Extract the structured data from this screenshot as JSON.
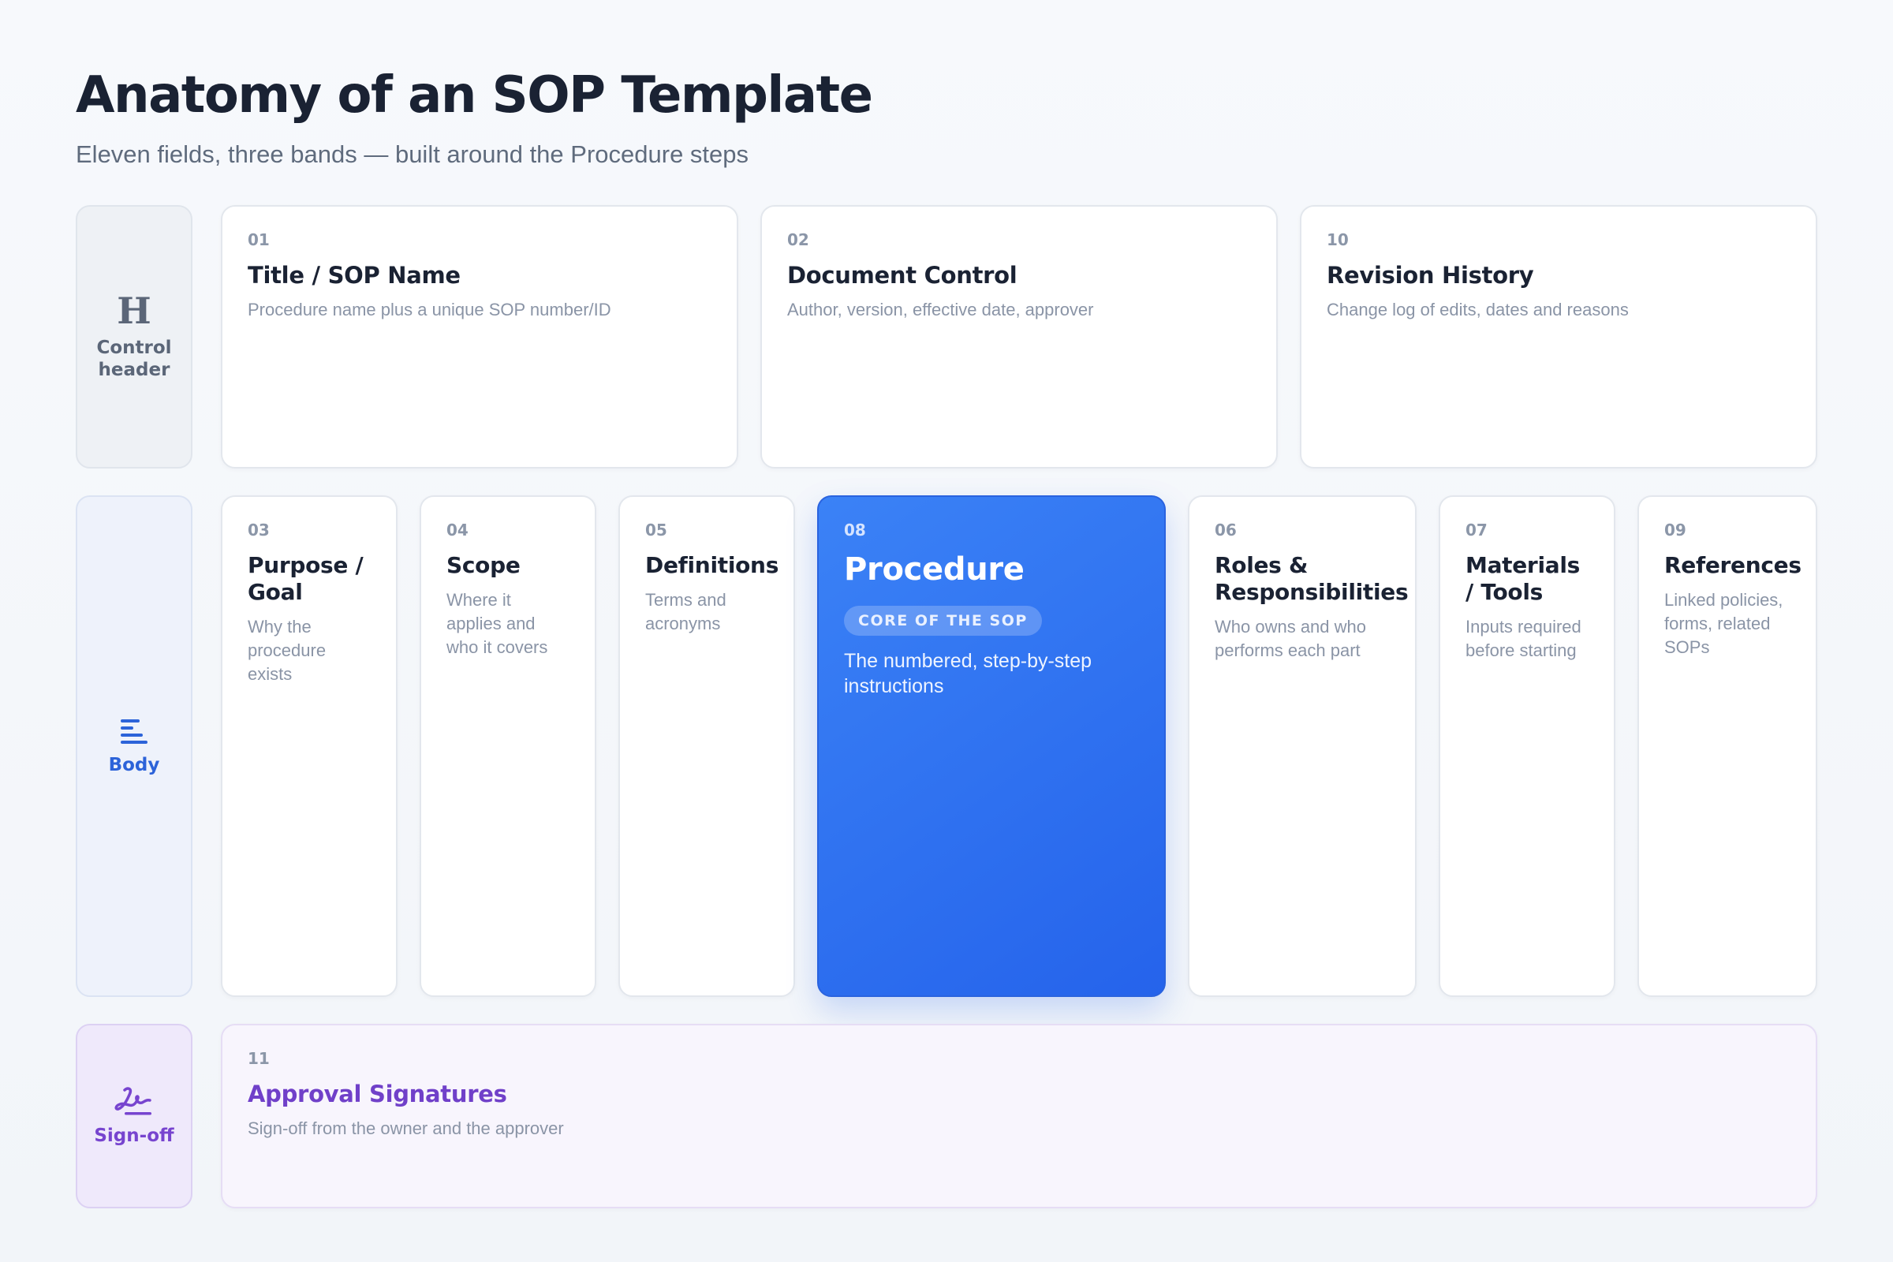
{
  "header": {
    "title": "Anatomy of an SOP Template",
    "subtitle": "Eleven fields, three bands — built around the Procedure steps"
  },
  "bands": {
    "header": {
      "icon": "h-letter-icon",
      "icon_glyph": "H",
      "label": "Control\nheader"
    },
    "body": {
      "icon": "text-lines-icon",
      "label": "Body"
    },
    "sign": {
      "icon": "signature-icon",
      "label": "Sign-off"
    }
  },
  "fields": {
    "f01": {
      "num": "01",
      "name": "Title / SOP Name",
      "desc": "Procedure name plus a unique SOP number/ID"
    },
    "f02": {
      "num": "02",
      "name": "Document Control",
      "desc": "Author, version, effective date, approver"
    },
    "f10": {
      "num": "10",
      "name": "Revision History",
      "desc": "Change log of edits, dates and reasons"
    },
    "f03": {
      "num": "03",
      "name": "Purpose / Goal",
      "desc": "Why the procedure exists"
    },
    "f04": {
      "num": "04",
      "name": "Scope",
      "desc": "Where it applies and who it covers"
    },
    "f05": {
      "num": "05",
      "name": "Definitions",
      "desc": "Terms and acronyms"
    },
    "f08": {
      "num": "08",
      "name": "Procedure",
      "badge": "CORE OF THE SOP",
      "desc": "The numbered, step-by-step instructions"
    },
    "f06": {
      "num": "06",
      "name": "Roles & Responsibilities",
      "desc": "Who owns and who performs each part"
    },
    "f07": {
      "num": "07",
      "name": "Materials / Tools",
      "desc": "Inputs required before starting"
    },
    "f09": {
      "num": "09",
      "name": "References",
      "desc": "Linked policies, forms, related SOPs"
    },
    "f11": {
      "num": "11",
      "name": "Approval Signatures",
      "desc": "Sign-off from the owner and the approver"
    }
  },
  "colors": {
    "accent": "#2563eb",
    "signoff": "#7040c9",
    "text": "#1a2233",
    "muted": "#8a94a6"
  }
}
